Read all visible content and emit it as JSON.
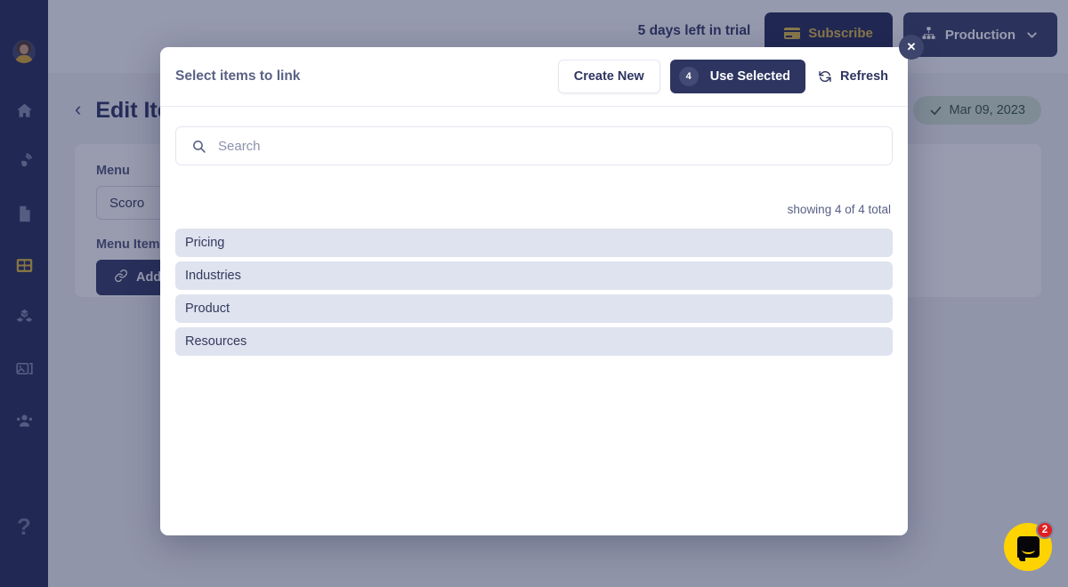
{
  "topbar": {
    "trial_text": "5 days left in trial",
    "subscribe_label": "Subscribe",
    "subscribe_icon": "credit-card-icon",
    "environment_label": "Production",
    "environment_icon": "sitemap-icon",
    "chevron_icon": "chevron-down-icon"
  },
  "sidebar": {
    "avatar": "user-avatar",
    "items": [
      {
        "icon": "home-icon",
        "active": false
      },
      {
        "icon": "broadcast-icon",
        "active": false
      },
      {
        "icon": "document-icon",
        "active": false
      },
      {
        "icon": "table-grid-icon",
        "active": true
      },
      {
        "icon": "cubes-icon",
        "active": false
      },
      {
        "icon": "media-image-icon",
        "active": false
      },
      {
        "icon": "users-icon",
        "active": false
      }
    ],
    "help_icon": "question-mark-icon",
    "help_label": "?"
  },
  "page": {
    "back_icon": "chevron-left-icon",
    "title": "Edit Item",
    "date_badge": {
      "icon": "check-icon",
      "label": "Mar 09, 2023"
    },
    "fields": [
      {
        "label": "Menu",
        "value": "Scoro"
      },
      {
        "label": "Menu Items",
        "value": ""
      }
    ],
    "add_reference_label": "Add reference",
    "add_reference_icon": "link-icon"
  },
  "modal": {
    "title": "Select items to link",
    "close_icon": "close-icon",
    "close_label": "✕",
    "create_new_label": "Create New",
    "use_selected_label": "Use Selected",
    "selected_count": "4",
    "refresh_label": "Refresh",
    "refresh_icon": "refresh-icon",
    "search": {
      "icon": "search-icon",
      "placeholder": "Search",
      "value": ""
    },
    "showing_text": "showing 4 of 4 total",
    "items": [
      {
        "label": "Pricing"
      },
      {
        "label": "Industries"
      },
      {
        "label": "Product"
      },
      {
        "label": "Resources"
      }
    ]
  },
  "chat": {
    "icon": "chat-bubble-icon",
    "unread_count": "2"
  },
  "colors": {
    "sidebar_bg": "#1d2451",
    "accent_navy": "#2e3560",
    "accent_gold": "#e0bc45",
    "item_bg": "#dfe3ef",
    "badge_green_bg": "#cfe0cf",
    "chat_yellow": "#ffd300",
    "chat_badge_red": "#e02020",
    "backdrop": "#8088a0"
  }
}
